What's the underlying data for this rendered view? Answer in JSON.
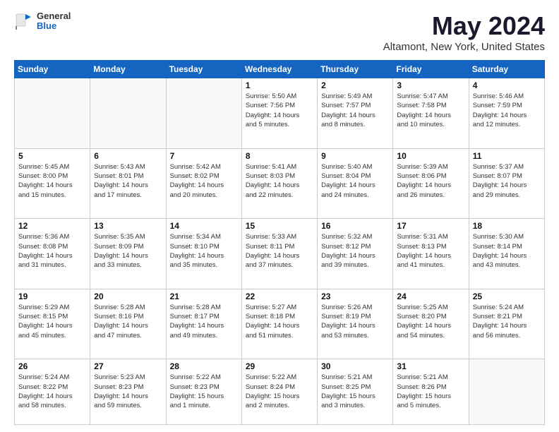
{
  "header": {
    "logo": {
      "general": "General",
      "blue": "Blue"
    },
    "title": "May 2024",
    "location": "Altamont, New York, United States"
  },
  "weekdays": [
    "Sunday",
    "Monday",
    "Tuesday",
    "Wednesday",
    "Thursday",
    "Friday",
    "Saturday"
  ],
  "weeks": [
    [
      {
        "day": "",
        "info": ""
      },
      {
        "day": "",
        "info": ""
      },
      {
        "day": "",
        "info": ""
      },
      {
        "day": "1",
        "info": "Sunrise: 5:50 AM\nSunset: 7:56 PM\nDaylight: 14 hours\nand 5 minutes."
      },
      {
        "day": "2",
        "info": "Sunrise: 5:49 AM\nSunset: 7:57 PM\nDaylight: 14 hours\nand 8 minutes."
      },
      {
        "day": "3",
        "info": "Sunrise: 5:47 AM\nSunset: 7:58 PM\nDaylight: 14 hours\nand 10 minutes."
      },
      {
        "day": "4",
        "info": "Sunrise: 5:46 AM\nSunset: 7:59 PM\nDaylight: 14 hours\nand 12 minutes."
      }
    ],
    [
      {
        "day": "5",
        "info": "Sunrise: 5:45 AM\nSunset: 8:00 PM\nDaylight: 14 hours\nand 15 minutes."
      },
      {
        "day": "6",
        "info": "Sunrise: 5:43 AM\nSunset: 8:01 PM\nDaylight: 14 hours\nand 17 minutes."
      },
      {
        "day": "7",
        "info": "Sunrise: 5:42 AM\nSunset: 8:02 PM\nDaylight: 14 hours\nand 20 minutes."
      },
      {
        "day": "8",
        "info": "Sunrise: 5:41 AM\nSunset: 8:03 PM\nDaylight: 14 hours\nand 22 minutes."
      },
      {
        "day": "9",
        "info": "Sunrise: 5:40 AM\nSunset: 8:04 PM\nDaylight: 14 hours\nand 24 minutes."
      },
      {
        "day": "10",
        "info": "Sunrise: 5:39 AM\nSunset: 8:06 PM\nDaylight: 14 hours\nand 26 minutes."
      },
      {
        "day": "11",
        "info": "Sunrise: 5:37 AM\nSunset: 8:07 PM\nDaylight: 14 hours\nand 29 minutes."
      }
    ],
    [
      {
        "day": "12",
        "info": "Sunrise: 5:36 AM\nSunset: 8:08 PM\nDaylight: 14 hours\nand 31 minutes."
      },
      {
        "day": "13",
        "info": "Sunrise: 5:35 AM\nSunset: 8:09 PM\nDaylight: 14 hours\nand 33 minutes."
      },
      {
        "day": "14",
        "info": "Sunrise: 5:34 AM\nSunset: 8:10 PM\nDaylight: 14 hours\nand 35 minutes."
      },
      {
        "day": "15",
        "info": "Sunrise: 5:33 AM\nSunset: 8:11 PM\nDaylight: 14 hours\nand 37 minutes."
      },
      {
        "day": "16",
        "info": "Sunrise: 5:32 AM\nSunset: 8:12 PM\nDaylight: 14 hours\nand 39 minutes."
      },
      {
        "day": "17",
        "info": "Sunrise: 5:31 AM\nSunset: 8:13 PM\nDaylight: 14 hours\nand 41 minutes."
      },
      {
        "day": "18",
        "info": "Sunrise: 5:30 AM\nSunset: 8:14 PM\nDaylight: 14 hours\nand 43 minutes."
      }
    ],
    [
      {
        "day": "19",
        "info": "Sunrise: 5:29 AM\nSunset: 8:15 PM\nDaylight: 14 hours\nand 45 minutes."
      },
      {
        "day": "20",
        "info": "Sunrise: 5:28 AM\nSunset: 8:16 PM\nDaylight: 14 hours\nand 47 minutes."
      },
      {
        "day": "21",
        "info": "Sunrise: 5:28 AM\nSunset: 8:17 PM\nDaylight: 14 hours\nand 49 minutes."
      },
      {
        "day": "22",
        "info": "Sunrise: 5:27 AM\nSunset: 8:18 PM\nDaylight: 14 hours\nand 51 minutes."
      },
      {
        "day": "23",
        "info": "Sunrise: 5:26 AM\nSunset: 8:19 PM\nDaylight: 14 hours\nand 53 minutes."
      },
      {
        "day": "24",
        "info": "Sunrise: 5:25 AM\nSunset: 8:20 PM\nDaylight: 14 hours\nand 54 minutes."
      },
      {
        "day": "25",
        "info": "Sunrise: 5:24 AM\nSunset: 8:21 PM\nDaylight: 14 hours\nand 56 minutes."
      }
    ],
    [
      {
        "day": "26",
        "info": "Sunrise: 5:24 AM\nSunset: 8:22 PM\nDaylight: 14 hours\nand 58 minutes."
      },
      {
        "day": "27",
        "info": "Sunrise: 5:23 AM\nSunset: 8:23 PM\nDaylight: 14 hours\nand 59 minutes."
      },
      {
        "day": "28",
        "info": "Sunrise: 5:22 AM\nSunset: 8:23 PM\nDaylight: 15 hours\nand 1 minute."
      },
      {
        "day": "29",
        "info": "Sunrise: 5:22 AM\nSunset: 8:24 PM\nDaylight: 15 hours\nand 2 minutes."
      },
      {
        "day": "30",
        "info": "Sunrise: 5:21 AM\nSunset: 8:25 PM\nDaylight: 15 hours\nand 3 minutes."
      },
      {
        "day": "31",
        "info": "Sunrise: 5:21 AM\nSunset: 8:26 PM\nDaylight: 15 hours\nand 5 minutes."
      },
      {
        "day": "",
        "info": ""
      }
    ]
  ]
}
